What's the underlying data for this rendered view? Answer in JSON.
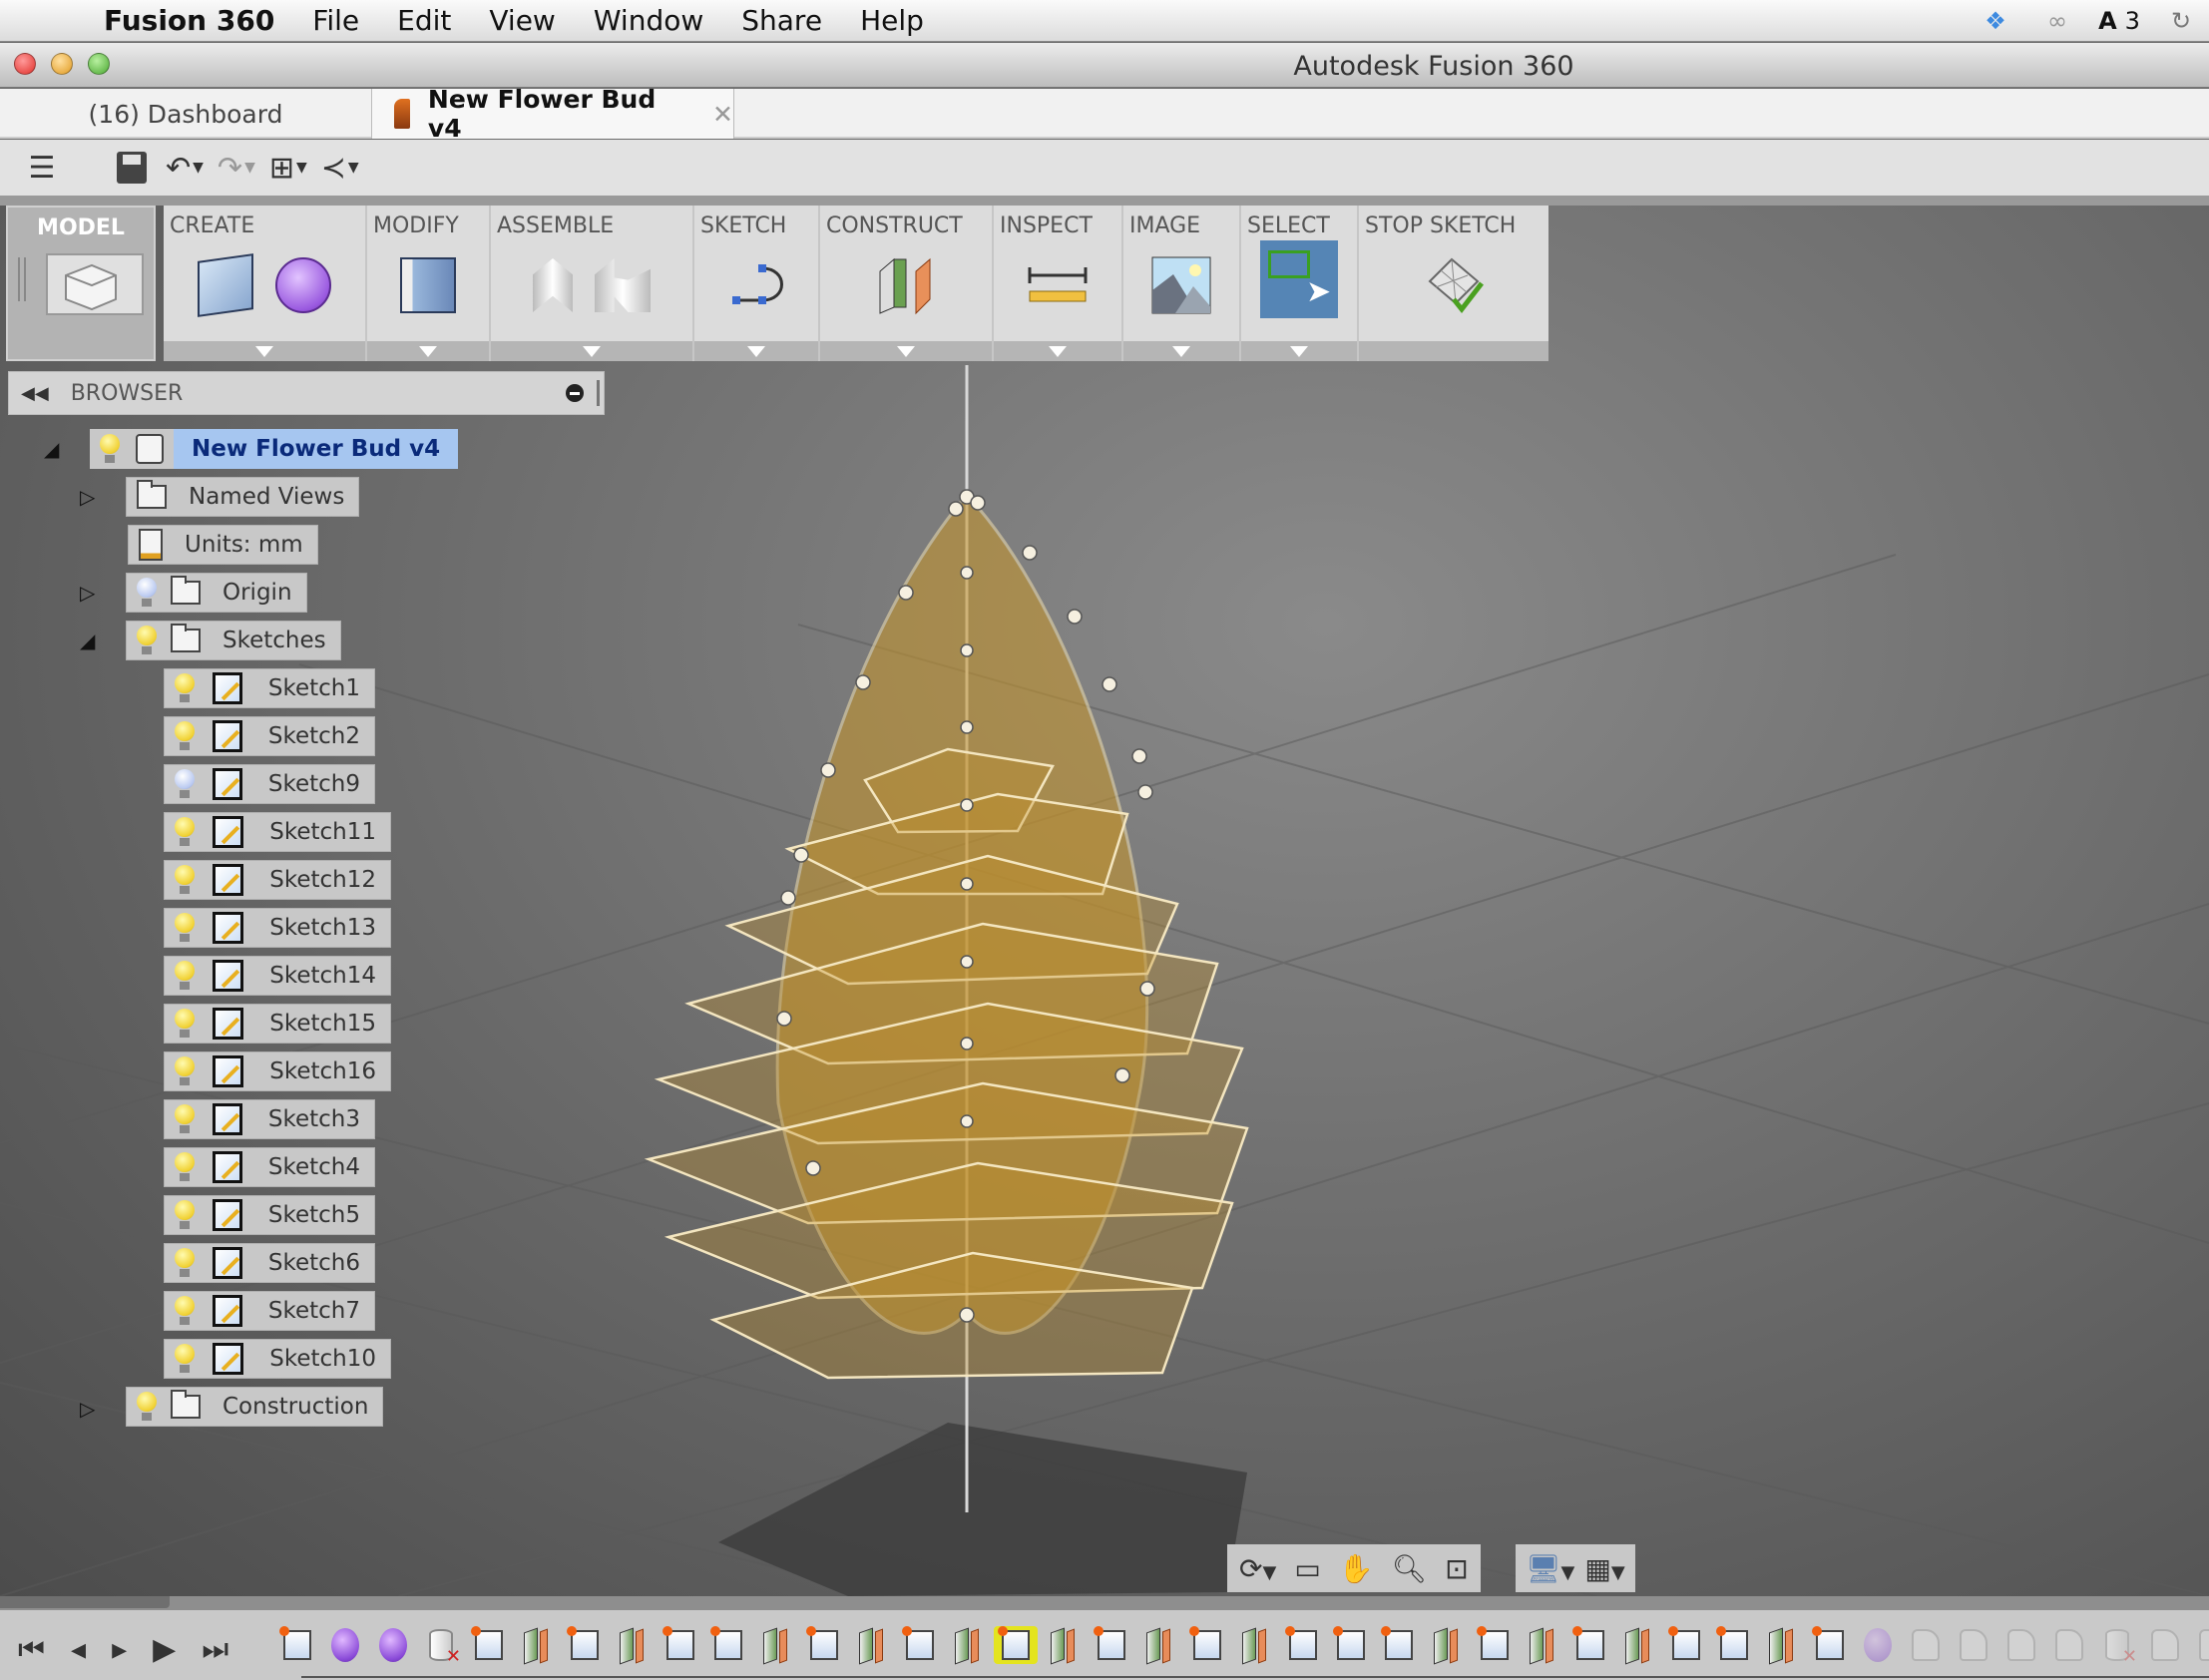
{
  "menubar": {
    "app_name": "Fusion 360",
    "items": [
      "File",
      "Edit",
      "View",
      "Window",
      "Share",
      "Help"
    ],
    "tray": {
      "dropbox": "dropbox-synced-icon",
      "creative_cloud": "creative-cloud-icon",
      "adobe_badge": "3"
    }
  },
  "window": {
    "title": "Autodesk Fusion 360"
  },
  "tabs": [
    {
      "label": "(16) Dashboard",
      "active": false
    },
    {
      "label": "New Flower Bud v4",
      "active": true,
      "close": "✕"
    }
  ],
  "quick_access": {
    "items": [
      "menu-icon",
      "save-icon",
      "undo-icon",
      "redo-icon",
      "data-structure-icon",
      "share-icon"
    ]
  },
  "ribbon": {
    "workspace": "MODEL",
    "panels": [
      {
        "label": "CREATE"
      },
      {
        "label": "MODIFY"
      },
      {
        "label": "ASSEMBLE"
      },
      {
        "label": "SKETCH"
      },
      {
        "label": "CONSTRUCT"
      },
      {
        "label": "INSPECT"
      },
      {
        "label": "IMAGE"
      },
      {
        "label": "SELECT",
        "active": true
      },
      {
        "label": "STOP SKETCH"
      }
    ]
  },
  "browser": {
    "title": "BROWSER",
    "root": {
      "label": "New Flower Bud v4"
    },
    "named_views": "Named Views",
    "units": "Units: mm",
    "origin": "Origin",
    "sketches_folder": "Sketches",
    "sketches": [
      {
        "label": "Sketch1",
        "visible": true
      },
      {
        "label": "Sketch2",
        "visible": true
      },
      {
        "label": "Sketch9",
        "visible": false
      },
      {
        "label": "Sketch11",
        "visible": true
      },
      {
        "label": "Sketch12",
        "visible": true
      },
      {
        "label": "Sketch13",
        "visible": true
      },
      {
        "label": "Sketch14",
        "visible": true
      },
      {
        "label": "Sketch15",
        "visible": true
      },
      {
        "label": "Sketch16",
        "visible": true
      },
      {
        "label": "Sketch3",
        "visible": true
      },
      {
        "label": "Sketch4",
        "visible": true
      },
      {
        "label": "Sketch5",
        "visible": true
      },
      {
        "label": "Sketch6",
        "visible": true
      },
      {
        "label": "Sketch7",
        "visible": true
      },
      {
        "label": "Sketch10",
        "visible": true
      }
    ],
    "construction": "Construction"
  },
  "navbar": {
    "items": [
      "orbit-icon",
      "look-at-icon",
      "pan-icon",
      "zoom-icon",
      "fit-icon"
    ],
    "display": [
      "display-settings-icon",
      "grid-settings-icon"
    ]
  },
  "timeline": {
    "controls": [
      "first",
      "previous",
      "play-step",
      "play",
      "last"
    ],
    "features": [
      "sketch",
      "form",
      "form",
      "delete",
      "sketch",
      "plane",
      "sketch",
      "plane",
      "sketch",
      "sketch",
      "plane",
      "sketch",
      "plane",
      "sketch",
      "plane",
      "sketch",
      "plane",
      "sketch",
      "plane",
      "sketch",
      "plane",
      "sketch",
      "sketch",
      "sketch",
      "plane",
      "sketch",
      "plane",
      "sketch",
      "plane",
      "sketch",
      "sketch",
      "plane",
      "sketch",
      "form",
      "generic",
      "generic",
      "generic",
      "move",
      "delete",
      "generic",
      "generic",
      "plane",
      "sketch",
      "extrude",
      "generic"
    ],
    "selected_index": 15,
    "active_count": 33
  },
  "colors": {
    "accent_select": "#5585b5",
    "timeline_highlight": "#e4e41e",
    "browser_root_highlight": "#a6c6f0",
    "body_fill": "#c8962a"
  }
}
